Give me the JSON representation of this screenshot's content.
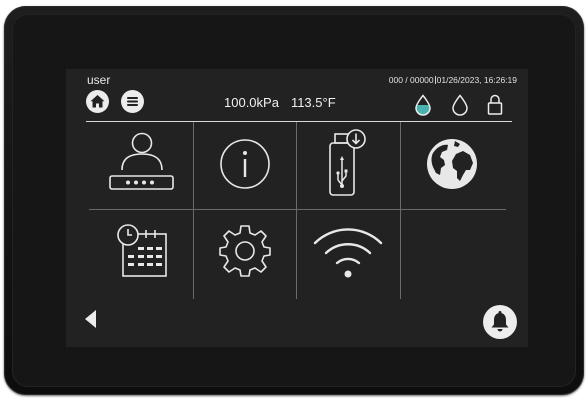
{
  "header": {
    "user": "user",
    "counter": "000 / 00000",
    "datetime": "01/26/2023, 16:26:19",
    "pressure": "100.0kPa",
    "temperature": "113.5°F"
  },
  "colors": {
    "accent_teal": "#4ab3b0",
    "icon_white": "#ececec",
    "screen_bg": "#222222",
    "bezel": "#161616"
  },
  "icons": {
    "home_button": "home-icon",
    "menu_button": "menu-icon",
    "status": [
      "water-drop-filled-icon",
      "water-drop-outline-icon",
      "lock-icon"
    ],
    "tiles": [
      "user-login-icon",
      "info-icon",
      "usb-download-icon",
      "globe-icon",
      "schedule-calendar-icon",
      "settings-gear-icon",
      "wifi-icon",
      "empty"
    ],
    "bottom": [
      "back-arrow-icon",
      "bell-icon"
    ]
  }
}
